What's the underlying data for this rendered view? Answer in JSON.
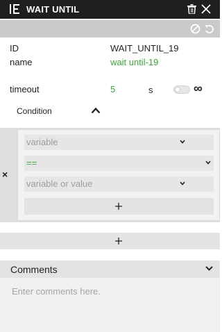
{
  "header": {
    "title": "WAIT UNTIL",
    "logo_icon": "ie-logo-icon",
    "delete_icon": "trash-icon",
    "close_icon": "close-icon"
  },
  "toolbar": {
    "disable_icon": "ban-icon",
    "reset_icon": "undo-icon"
  },
  "properties": {
    "id_label": "ID",
    "id_value": "WAIT_UNTIL_19",
    "name_label": "name",
    "name_value": "wait until-19",
    "timeout_label": "timeout",
    "timeout_value": "5",
    "timeout_unit": "s",
    "infinite_symbol": "∞",
    "infinite_enabled": false
  },
  "condition": {
    "label": "Condition",
    "remove_symbol": "×",
    "left_placeholder": "variable",
    "operator": "==",
    "right_placeholder": "variable or value"
  },
  "comments": {
    "label": "Comments",
    "placeholder": "Enter comments here."
  },
  "colors": {
    "accent_green": "#3aaa35",
    "titlebar": "#1f1f1f"
  }
}
